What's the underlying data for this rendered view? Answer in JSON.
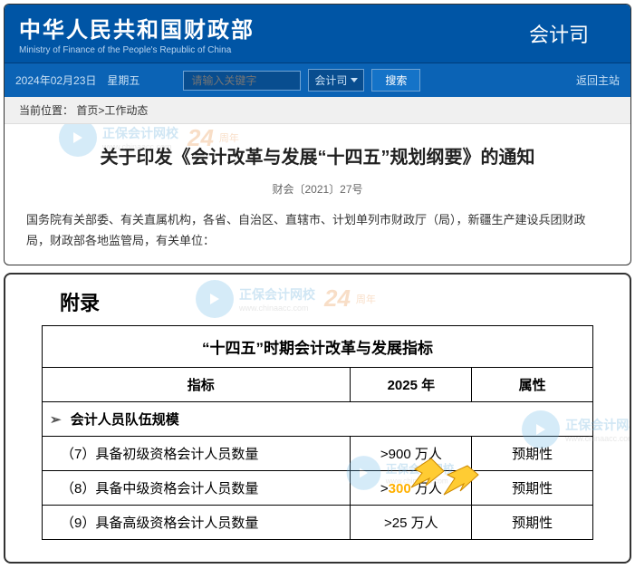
{
  "header": {
    "title": "中华人民共和国财政部",
    "subtitle": "Ministry of Finance of the People's Republic of China",
    "dept": "会计司"
  },
  "nav": {
    "date": "2024年02月23日 星期五",
    "placeholder": "请输入关键字",
    "select": "会计司",
    "search_btn": "搜索",
    "return": "返回主站"
  },
  "breadcrumb": {
    "label": "当前位置：",
    "home": "首页",
    "sep": ">",
    "current": "工作动态"
  },
  "article": {
    "title": "关于印发《会计改革与发展“十四五”规划纲要》的通知",
    "docnum": "财会〔2021〕27号",
    "body": "国务院有关部委、有关直属机构，各省、自治区、直辖市、计划单列市财政厅（局），新疆生产建设兵团财政局，财政部各地监管局，有关单位："
  },
  "appendix": {
    "title": "附录",
    "table_title": "“十四五”时期会计改革与发展指标",
    "headers": {
      "indicator": "指标",
      "year": "2025 年",
      "attr": "属性"
    },
    "section": "会计人员队伍规模",
    "rows": [
      {
        "indicator": "（7）具备初级资格会计人员数量",
        "value": ">900 万人",
        "attr": "预期性"
      },
      {
        "indicator": "（8）具备中级资格会计人员数量",
        "value_prefix": ">",
        "value_hl": "300",
        "value_suffix": " 万人",
        "attr": "预期性"
      },
      {
        "indicator": "（9）具备高级资格会计人员数量",
        "value": ">25 万人",
        "attr": "预期性"
      }
    ]
  },
  "watermark": {
    "name": "正保会计网校",
    "url": "www.chinaacc.com",
    "badge": "24",
    "badge_sub": "周年"
  }
}
